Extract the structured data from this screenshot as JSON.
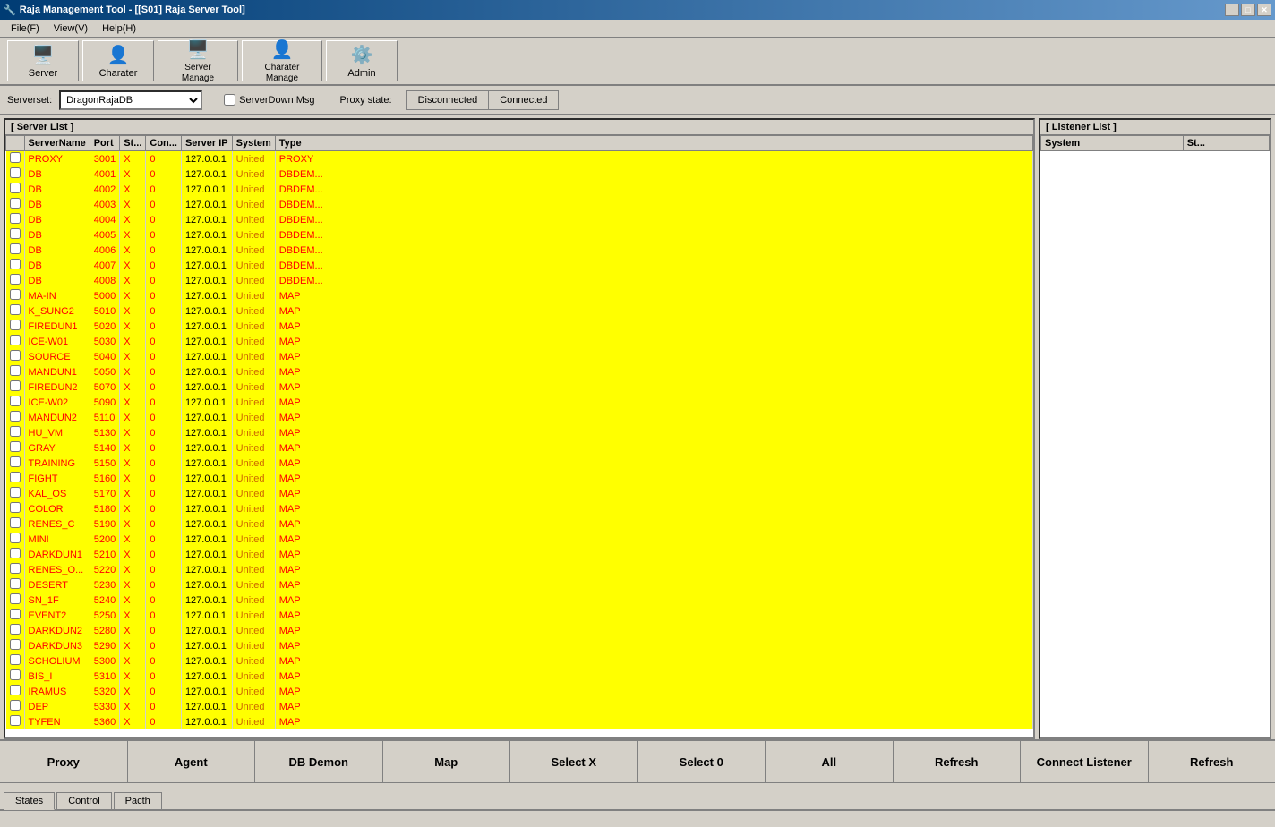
{
  "titleBar": {
    "title": "Raja Management Tool - [[S01] Raja Server Tool]",
    "controls": [
      "minimize",
      "maximize",
      "close"
    ]
  },
  "menuBar": {
    "items": [
      {
        "id": "file",
        "label": "File(F)"
      },
      {
        "id": "view",
        "label": "View(V)"
      },
      {
        "id": "help",
        "label": "Help(H)"
      }
    ]
  },
  "toolbar": {
    "buttons": [
      {
        "id": "server",
        "label": "Server"
      },
      {
        "id": "charater",
        "label": "Charater"
      },
      {
        "id": "server-manage",
        "label": "Server\nManage"
      },
      {
        "id": "charater-manage",
        "label": "Charater\nManage"
      },
      {
        "id": "admin",
        "label": "Admin"
      }
    ]
  },
  "serversetRow": {
    "serversetLabel": "Serverset:",
    "serversetValue": "DragonRajaDB",
    "checkboxLabel": "ServerDown Msg",
    "proxyStateLabel": "Proxy state:",
    "disconnectedLabel": "Disconnected",
    "connectedLabel": "Connected"
  },
  "serverListPanel": {
    "title": "[ Server List ]",
    "columns": [
      "ServerName",
      "Port",
      "St...",
      "Con...",
      "Server IP",
      "System",
      "Type"
    ],
    "rows": [
      {
        "name": "PROXY",
        "port": "3001",
        "st": "X",
        "con": "0",
        "ip": "127.0.0.1",
        "system": "United",
        "type": "PROXY"
      },
      {
        "name": "DB",
        "port": "4001",
        "st": "X",
        "con": "0",
        "ip": "127.0.0.1",
        "system": "United",
        "type": "DBDEM..."
      },
      {
        "name": "DB",
        "port": "4002",
        "st": "X",
        "con": "0",
        "ip": "127.0.0.1",
        "system": "United",
        "type": "DBDEM..."
      },
      {
        "name": "DB",
        "port": "4003",
        "st": "X",
        "con": "0",
        "ip": "127.0.0.1",
        "system": "United",
        "type": "DBDEM..."
      },
      {
        "name": "DB",
        "port": "4004",
        "st": "X",
        "con": "0",
        "ip": "127.0.0.1",
        "system": "United",
        "type": "DBDEM..."
      },
      {
        "name": "DB",
        "port": "4005",
        "st": "X",
        "con": "0",
        "ip": "127.0.0.1",
        "system": "United",
        "type": "DBDEM..."
      },
      {
        "name": "DB",
        "port": "4006",
        "st": "X",
        "con": "0",
        "ip": "127.0.0.1",
        "system": "United",
        "type": "DBDEM..."
      },
      {
        "name": "DB",
        "port": "4007",
        "st": "X",
        "con": "0",
        "ip": "127.0.0.1",
        "system": "United",
        "type": "DBDEM..."
      },
      {
        "name": "DB",
        "port": "4008",
        "st": "X",
        "con": "0",
        "ip": "127.0.0.1",
        "system": "United",
        "type": "DBDEM..."
      },
      {
        "name": "MA-IN",
        "port": "5000",
        "st": "X",
        "con": "0",
        "ip": "127.0.0.1",
        "system": "United",
        "type": "MAP"
      },
      {
        "name": "K_SUNG2",
        "port": "5010",
        "st": "X",
        "con": "0",
        "ip": "127.0.0.1",
        "system": "United",
        "type": "MAP"
      },
      {
        "name": "FIREDUN1",
        "port": "5020",
        "st": "X",
        "con": "0",
        "ip": "127.0.0.1",
        "system": "United",
        "type": "MAP"
      },
      {
        "name": "ICE-W01",
        "port": "5030",
        "st": "X",
        "con": "0",
        "ip": "127.0.0.1",
        "system": "United",
        "type": "MAP"
      },
      {
        "name": "SOURCE",
        "port": "5040",
        "st": "X",
        "con": "0",
        "ip": "127.0.0.1",
        "system": "United",
        "type": "MAP"
      },
      {
        "name": "MANDUN1",
        "port": "5050",
        "st": "X",
        "con": "0",
        "ip": "127.0.0.1",
        "system": "United",
        "type": "MAP"
      },
      {
        "name": "FIREDUN2",
        "port": "5070",
        "st": "X",
        "con": "0",
        "ip": "127.0.0.1",
        "system": "United",
        "type": "MAP"
      },
      {
        "name": "ICE-W02",
        "port": "5090",
        "st": "X",
        "con": "0",
        "ip": "127.0.0.1",
        "system": "United",
        "type": "MAP"
      },
      {
        "name": "MANDUN2",
        "port": "5110",
        "st": "X",
        "con": "0",
        "ip": "127.0.0.1",
        "system": "United",
        "type": "MAP"
      },
      {
        "name": "HU_VM",
        "port": "5130",
        "st": "X",
        "con": "0",
        "ip": "127.0.0.1",
        "system": "United",
        "type": "MAP"
      },
      {
        "name": "GRAY",
        "port": "5140",
        "st": "X",
        "con": "0",
        "ip": "127.0.0.1",
        "system": "United",
        "type": "MAP"
      },
      {
        "name": "TRAINING",
        "port": "5150",
        "st": "X",
        "con": "0",
        "ip": "127.0.0.1",
        "system": "United",
        "type": "MAP"
      },
      {
        "name": "FIGHT",
        "port": "5160",
        "st": "X",
        "con": "0",
        "ip": "127.0.0.1",
        "system": "United",
        "type": "MAP"
      },
      {
        "name": "KAL_OS",
        "port": "5170",
        "st": "X",
        "con": "0",
        "ip": "127.0.0.1",
        "system": "United",
        "type": "MAP"
      },
      {
        "name": "COLOR",
        "port": "5180",
        "st": "X",
        "con": "0",
        "ip": "127.0.0.1",
        "system": "United",
        "type": "MAP"
      },
      {
        "name": "RENES_C",
        "port": "5190",
        "st": "X",
        "con": "0",
        "ip": "127.0.0.1",
        "system": "United",
        "type": "MAP"
      },
      {
        "name": "MINI",
        "port": "5200",
        "st": "X",
        "con": "0",
        "ip": "127.0.0.1",
        "system": "United",
        "type": "MAP"
      },
      {
        "name": "DARKDUN1",
        "port": "5210",
        "st": "X",
        "con": "0",
        "ip": "127.0.0.1",
        "system": "United",
        "type": "MAP"
      },
      {
        "name": "RENES_O...",
        "port": "5220",
        "st": "X",
        "con": "0",
        "ip": "127.0.0.1",
        "system": "United",
        "type": "MAP"
      },
      {
        "name": "DESERT",
        "port": "5230",
        "st": "X",
        "con": "0",
        "ip": "127.0.0.1",
        "system": "United",
        "type": "MAP"
      },
      {
        "name": "SN_1F",
        "port": "5240",
        "st": "X",
        "con": "0",
        "ip": "127.0.0.1",
        "system": "United",
        "type": "MAP"
      },
      {
        "name": "EVENT2",
        "port": "5250",
        "st": "X",
        "con": "0",
        "ip": "127.0.0.1",
        "system": "United",
        "type": "MAP"
      },
      {
        "name": "DARKDUN2",
        "port": "5280",
        "st": "X",
        "con": "0",
        "ip": "127.0.0.1",
        "system": "United",
        "type": "MAP"
      },
      {
        "name": "DARKDUN3",
        "port": "5290",
        "st": "X",
        "con": "0",
        "ip": "127.0.0.1",
        "system": "United",
        "type": "MAP"
      },
      {
        "name": "SCHOLIUM",
        "port": "5300",
        "st": "X",
        "con": "0",
        "ip": "127.0.0.1",
        "system": "United",
        "type": "MAP"
      },
      {
        "name": "BIS_I",
        "port": "5310",
        "st": "X",
        "con": "0",
        "ip": "127.0.0.1",
        "system": "United",
        "type": "MAP"
      },
      {
        "name": "IRAMUS",
        "port": "5320",
        "st": "X",
        "con": "0",
        "ip": "127.0.0.1",
        "system": "United",
        "type": "MAP"
      },
      {
        "name": "DEP",
        "port": "5330",
        "st": "X",
        "con": "0",
        "ip": "127.0.0.1",
        "system": "United",
        "type": "MAP"
      },
      {
        "name": "TYFEN",
        "port": "5360",
        "st": "X",
        "con": "0",
        "ip": "127.0.0.1",
        "system": "United",
        "type": "MAP"
      }
    ]
  },
  "listenerListPanel": {
    "title": "[ Listener List ]",
    "columns": [
      "System",
      "St..."
    ]
  },
  "bottomButtons": [
    {
      "id": "proxy",
      "label": "Proxy"
    },
    {
      "id": "agent",
      "label": "Agent"
    },
    {
      "id": "db-demon",
      "label": "DB Demon"
    },
    {
      "id": "map",
      "label": "Map"
    },
    {
      "id": "select-x",
      "label": "Select X"
    },
    {
      "id": "select-0",
      "label": "Select 0"
    },
    {
      "id": "all",
      "label": "All"
    },
    {
      "id": "refresh-main",
      "label": "Refresh"
    },
    {
      "id": "connect-listener",
      "label": "Connect Listener"
    },
    {
      "id": "refresh-listener",
      "label": "Refresh"
    }
  ],
  "tabs": [
    {
      "id": "states",
      "label": "States"
    },
    {
      "id": "control",
      "label": "Control"
    },
    {
      "id": "pacth",
      "label": "Pacth"
    }
  ],
  "statusBar": {
    "text": ""
  }
}
